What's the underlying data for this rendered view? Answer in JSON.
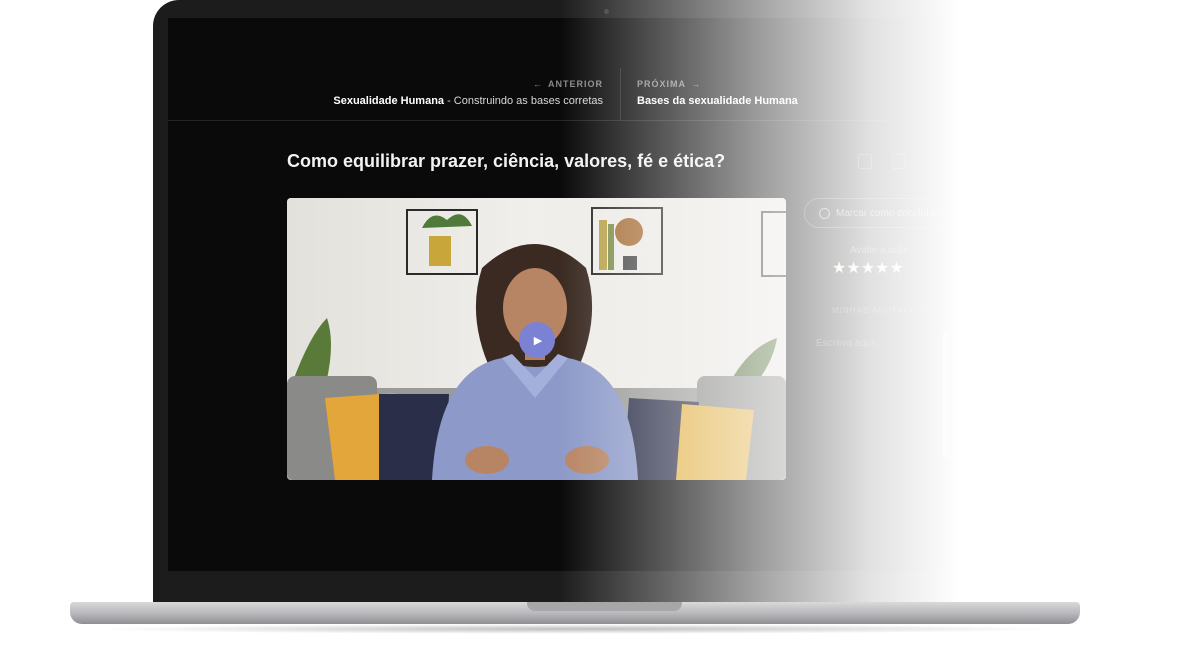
{
  "nav": {
    "prev": {
      "kicker": "ANTERIOR",
      "title_bold": "Sexualidade Humana",
      "title_rest": " - Construindo as bases corretas"
    },
    "next": {
      "kicker": "PRÓXIMA",
      "title_bold": "Bases da sexualidade Humana"
    }
  },
  "lesson": {
    "title": "Como equilibrar prazer, ciência, valores, fé e ética?"
  },
  "panel": {
    "complete_button": "Marcar como concluído",
    "rate_label": "Avalie a aula",
    "stars": "★★★★★",
    "notes_label": "MINHAS ANOTAÇÕES",
    "notes_placeholder": "Escreva aqui..."
  },
  "icons": {
    "prev_arrow": "←",
    "next_arrow": "→",
    "play": "▶"
  },
  "colors": {
    "screen_bg": "#0a0a0b",
    "accent_play": "#7b82d4",
    "star": "#f0ead2"
  }
}
